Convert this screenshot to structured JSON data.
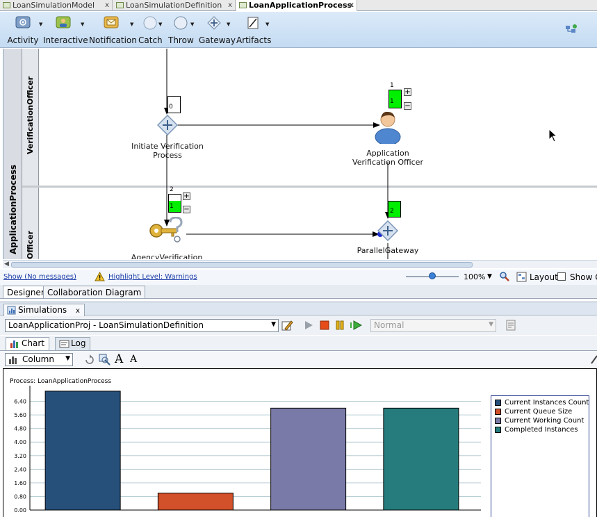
{
  "tabs": [
    {
      "label": "LoanSimulationModel",
      "active": false
    },
    {
      "label": "LoanSimulationDefinition",
      "active": false
    },
    {
      "label": "LoanApplicationProcess",
      "active": true
    }
  ],
  "tab_close": "x",
  "palette": {
    "items": [
      {
        "label": "Activity",
        "icon": "activity-icon"
      },
      {
        "label": "Interactive",
        "icon": "interactive-user-icon"
      },
      {
        "label": "Notification",
        "icon": "envelope-icon"
      },
      {
        "label": "Catch",
        "icon": "catch-event-icon"
      },
      {
        "label": "Throw",
        "icon": "throw-event-icon"
      },
      {
        "label": "Gateway",
        "icon": "gateway-icon"
      },
      {
        "label": "Artifacts",
        "icon": "artifacts-icon"
      }
    ]
  },
  "diagram": {
    "pool_name": "ApplicationProcess",
    "lanes": [
      "VerificationOfficer",
      "Officer"
    ],
    "nodes": {
      "initiate_verification": {
        "label_line1": "Initiate Verification",
        "label_line2": "Process",
        "counter": "0"
      },
      "application_verification": {
        "label_line1": "Application",
        "label_line2": "Verification Officer",
        "counter_top": "1",
        "counter_green": "1"
      },
      "agency_verification": {
        "label": "AgencyVerification",
        "counter_top": "2",
        "counter_green": "1"
      },
      "parallel_gateway": {
        "label": "ParallelGateway",
        "counter_green": "2"
      }
    },
    "plus": "+",
    "minus": "−"
  },
  "status": {
    "show_messages": "Show (No messages)",
    "highlight_level": "Highlight Level: Warnings",
    "zoom": "100%",
    "layout": "Layout",
    "show_grid": "Show G"
  },
  "designer_tabs": [
    "Designer",
    "Collaboration Diagram"
  ],
  "simulations": {
    "tab_label": "Simulations",
    "close": "x",
    "definition_select": "LoanApplicationProj - LoanSimulationDefinition",
    "speed_select": "Normal",
    "subtabs": [
      "Chart",
      "Log"
    ],
    "chart_type": "Column"
  },
  "colors": {
    "accent": "#c4dbf2",
    "green_counter": "#00ee00"
  },
  "chart_data": {
    "type": "bar",
    "title": "Process: LoanApplicationProcess",
    "categories": [
      "",
      "",
      "",
      ""
    ],
    "series": [
      {
        "name": "Current Instances Count",
        "values": [
          7
        ],
        "color": "#26507a"
      },
      {
        "name": "Current Queue Size",
        "values": [
          1
        ],
        "color": "#d2502a"
      },
      {
        "name": "Current Working Count",
        "values": [
          6
        ],
        "color": "#7a7aa8"
      },
      {
        "name": "Completed Instances",
        "values": [
          6
        ],
        "color": "#267c7c"
      }
    ],
    "ytick_labels": [
      "0.00",
      "0.80",
      "1.60",
      "2.40",
      "3.20",
      "4.00",
      "4.80",
      "5.60",
      "6.40"
    ],
    "ylim": [
      0,
      7.2
    ],
    "grid": true,
    "legend_position": "right"
  }
}
